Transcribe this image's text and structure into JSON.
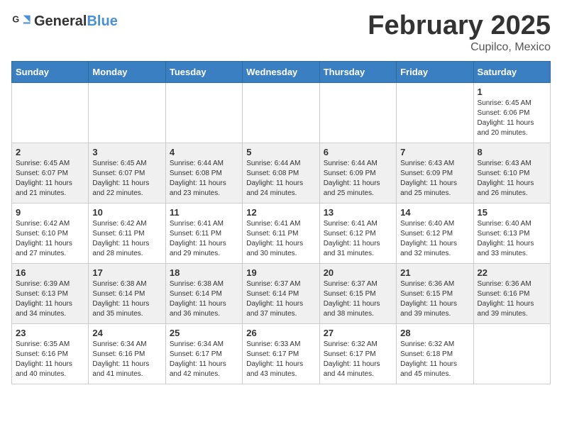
{
  "header": {
    "logo_general": "General",
    "logo_blue": "Blue",
    "month_year": "February 2025",
    "location": "Cupilco, Mexico"
  },
  "days_of_week": [
    "Sunday",
    "Monday",
    "Tuesday",
    "Wednesday",
    "Thursday",
    "Friday",
    "Saturday"
  ],
  "weeks": [
    [
      {
        "day": "",
        "info": ""
      },
      {
        "day": "",
        "info": ""
      },
      {
        "day": "",
        "info": ""
      },
      {
        "day": "",
        "info": ""
      },
      {
        "day": "",
        "info": ""
      },
      {
        "day": "",
        "info": ""
      },
      {
        "day": "1",
        "info": "Sunrise: 6:45 AM\nSunset: 6:06 PM\nDaylight: 11 hours\nand 20 minutes."
      }
    ],
    [
      {
        "day": "2",
        "info": "Sunrise: 6:45 AM\nSunset: 6:07 PM\nDaylight: 11 hours\nand 21 minutes."
      },
      {
        "day": "3",
        "info": "Sunrise: 6:45 AM\nSunset: 6:07 PM\nDaylight: 11 hours\nand 22 minutes."
      },
      {
        "day": "4",
        "info": "Sunrise: 6:44 AM\nSunset: 6:08 PM\nDaylight: 11 hours\nand 23 minutes."
      },
      {
        "day": "5",
        "info": "Sunrise: 6:44 AM\nSunset: 6:08 PM\nDaylight: 11 hours\nand 24 minutes."
      },
      {
        "day": "6",
        "info": "Sunrise: 6:44 AM\nSunset: 6:09 PM\nDaylight: 11 hours\nand 25 minutes."
      },
      {
        "day": "7",
        "info": "Sunrise: 6:43 AM\nSunset: 6:09 PM\nDaylight: 11 hours\nand 25 minutes."
      },
      {
        "day": "8",
        "info": "Sunrise: 6:43 AM\nSunset: 6:10 PM\nDaylight: 11 hours\nand 26 minutes."
      }
    ],
    [
      {
        "day": "9",
        "info": "Sunrise: 6:42 AM\nSunset: 6:10 PM\nDaylight: 11 hours\nand 27 minutes."
      },
      {
        "day": "10",
        "info": "Sunrise: 6:42 AM\nSunset: 6:11 PM\nDaylight: 11 hours\nand 28 minutes."
      },
      {
        "day": "11",
        "info": "Sunrise: 6:41 AM\nSunset: 6:11 PM\nDaylight: 11 hours\nand 29 minutes."
      },
      {
        "day": "12",
        "info": "Sunrise: 6:41 AM\nSunset: 6:11 PM\nDaylight: 11 hours\nand 30 minutes."
      },
      {
        "day": "13",
        "info": "Sunrise: 6:41 AM\nSunset: 6:12 PM\nDaylight: 11 hours\nand 31 minutes."
      },
      {
        "day": "14",
        "info": "Sunrise: 6:40 AM\nSunset: 6:12 PM\nDaylight: 11 hours\nand 32 minutes."
      },
      {
        "day": "15",
        "info": "Sunrise: 6:40 AM\nSunset: 6:13 PM\nDaylight: 11 hours\nand 33 minutes."
      }
    ],
    [
      {
        "day": "16",
        "info": "Sunrise: 6:39 AM\nSunset: 6:13 PM\nDaylight: 11 hours\nand 34 minutes."
      },
      {
        "day": "17",
        "info": "Sunrise: 6:38 AM\nSunset: 6:14 PM\nDaylight: 11 hours\nand 35 minutes."
      },
      {
        "day": "18",
        "info": "Sunrise: 6:38 AM\nSunset: 6:14 PM\nDaylight: 11 hours\nand 36 minutes."
      },
      {
        "day": "19",
        "info": "Sunrise: 6:37 AM\nSunset: 6:14 PM\nDaylight: 11 hours\nand 37 minutes."
      },
      {
        "day": "20",
        "info": "Sunrise: 6:37 AM\nSunset: 6:15 PM\nDaylight: 11 hours\nand 38 minutes."
      },
      {
        "day": "21",
        "info": "Sunrise: 6:36 AM\nSunset: 6:15 PM\nDaylight: 11 hours\nand 39 minutes."
      },
      {
        "day": "22",
        "info": "Sunrise: 6:36 AM\nSunset: 6:16 PM\nDaylight: 11 hours\nand 39 minutes."
      }
    ],
    [
      {
        "day": "23",
        "info": "Sunrise: 6:35 AM\nSunset: 6:16 PM\nDaylight: 11 hours\nand 40 minutes."
      },
      {
        "day": "24",
        "info": "Sunrise: 6:34 AM\nSunset: 6:16 PM\nDaylight: 11 hours\nand 41 minutes."
      },
      {
        "day": "25",
        "info": "Sunrise: 6:34 AM\nSunset: 6:17 PM\nDaylight: 11 hours\nand 42 minutes."
      },
      {
        "day": "26",
        "info": "Sunrise: 6:33 AM\nSunset: 6:17 PM\nDaylight: 11 hours\nand 43 minutes."
      },
      {
        "day": "27",
        "info": "Sunrise: 6:32 AM\nSunset: 6:17 PM\nDaylight: 11 hours\nand 44 minutes."
      },
      {
        "day": "28",
        "info": "Sunrise: 6:32 AM\nSunset: 6:18 PM\nDaylight: 11 hours\nand 45 minutes."
      },
      {
        "day": "",
        "info": ""
      }
    ]
  ]
}
